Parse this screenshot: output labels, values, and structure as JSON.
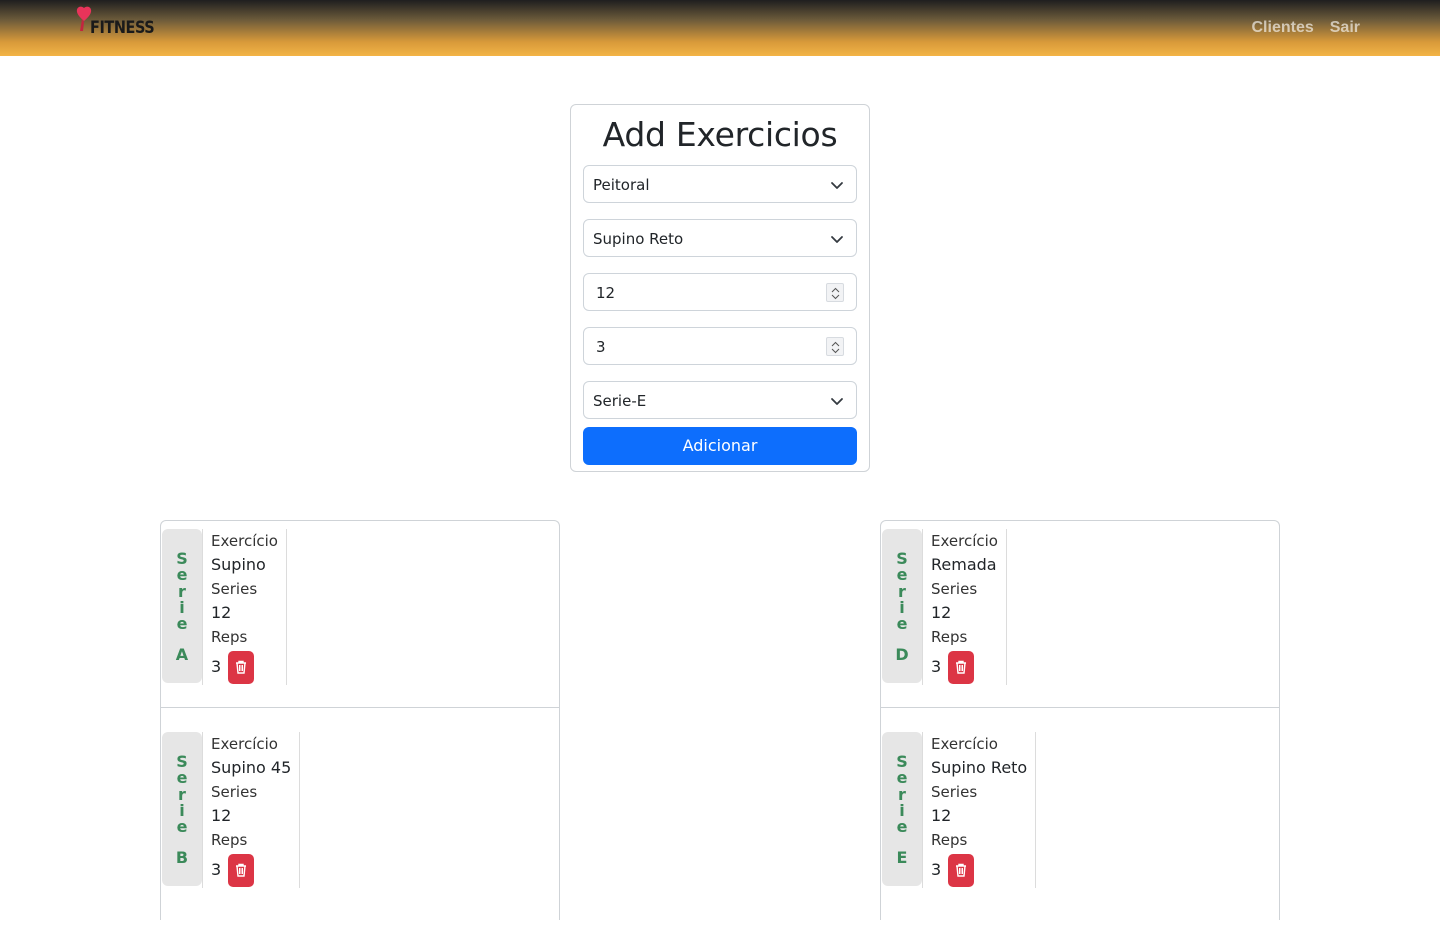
{
  "header": {
    "logo_text": "FITNESS",
    "nav": [
      "Clientes",
      "Sair"
    ]
  },
  "form": {
    "title": "Add Exercicios",
    "group_select": "Peitoral",
    "exercise_select": "Supino Reto",
    "series_input": "12",
    "reps_input": "3",
    "serie_select": "Serie-E",
    "submit_label": "Adicionar"
  },
  "labels": {
    "exercise": "Exercício",
    "series": "Series",
    "reps": "Reps"
  },
  "series_cards": [
    {
      "serie": "A",
      "exercise": "Supino",
      "series": "12",
      "reps": "3"
    },
    {
      "serie": "B",
      "exercise": "Supino 45",
      "series": "12",
      "reps": "3"
    },
    {
      "serie": "D",
      "exercise": "Remada",
      "series": "12",
      "reps": "3"
    },
    {
      "serie": "E",
      "exercise": "Supino Reto",
      "series": "12",
      "reps": "3"
    }
  ],
  "serie_word": "Serie",
  "colors": {
    "primary": "#0d6efd",
    "danger": "#dc3545",
    "serie_text": "#3b8a5a",
    "brand": "#e8345a"
  }
}
